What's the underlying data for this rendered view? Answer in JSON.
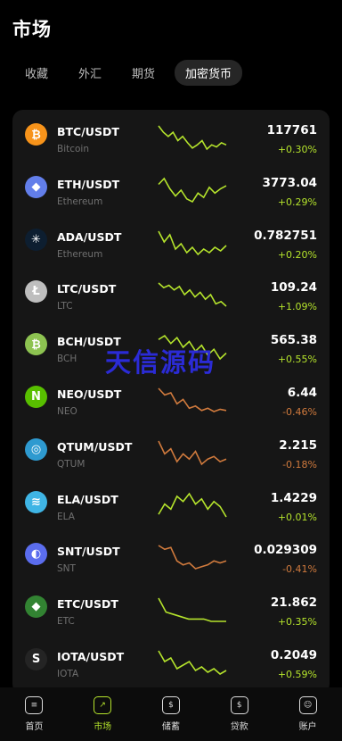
{
  "header": {
    "title": "市场"
  },
  "tabs": [
    {
      "label": "收藏",
      "active": false
    },
    {
      "label": "外汇",
      "active": false
    },
    {
      "label": "期货",
      "active": false
    },
    {
      "label": "加密货币",
      "active": true
    }
  ],
  "colors": {
    "up": "#b5e42c",
    "down": "#d07a3d",
    "background": "#000000",
    "card": "#161616"
  },
  "markets": [
    {
      "pair": "BTC/USDT",
      "name": "Bitcoin",
      "price": "117761",
      "change": "+0.30%",
      "trend": "up",
      "icon": "bitcoin-icon",
      "icon_glyph": "₿",
      "icon_color": "#f7931a",
      "spark": [
        24,
        30,
        34,
        30,
        38,
        34,
        40,
        45,
        42,
        38,
        46,
        42,
        44,
        40,
        42
      ]
    },
    {
      "pair": "ETH/USDT",
      "name": "Ethereum",
      "price": "3773.04",
      "change": "+0.29%",
      "trend": "up",
      "icon": "ethereum-icon",
      "icon_glyph": "◆",
      "icon_color": "#627eea",
      "spark": [
        30,
        26,
        33,
        38,
        34,
        40,
        42,
        36,
        39,
        32,
        36,
        33,
        31
      ]
    },
    {
      "pair": "ADA/USDT",
      "name": "Ethereum",
      "price": "0.782751",
      "change": "+0.20%",
      "trend": "up",
      "icon": "cardano-icon",
      "icon_glyph": "✳",
      "icon_color": "#0d1e30",
      "spark": [
        28,
        34,
        30,
        38,
        35,
        40,
        37,
        41,
        38,
        40,
        37,
        39,
        36
      ]
    },
    {
      "pair": "LTC/USDT",
      "name": "LTC",
      "price": "109.24",
      "change": "+1.09%",
      "trend": "up",
      "icon": "litecoin-icon",
      "icon_glyph": "Ł",
      "icon_color": "#bebebe",
      "spark": [
        24,
        28,
        26,
        30,
        27,
        34,
        30,
        36,
        32,
        38,
        34,
        42,
        40,
        44
      ]
    },
    {
      "pair": "BCH/USDT",
      "name": "BCH",
      "price": "565.38",
      "change": "+0.55%",
      "trend": "up",
      "icon": "bitcoin-cash-icon",
      "icon_glyph": "₿",
      "icon_color": "#8dc351",
      "spark": [
        28,
        26,
        30,
        27,
        32,
        29,
        34,
        31,
        36,
        33,
        38,
        35
      ]
    },
    {
      "pair": "NEO/USDT",
      "name": "NEO",
      "price": "6.44",
      "change": "-0.46%",
      "trend": "down",
      "icon": "neo-icon",
      "icon_glyph": "N",
      "icon_color": "#58bf00",
      "spark": [
        22,
        28,
        26,
        36,
        32,
        40,
        38,
        42,
        40,
        43,
        41,
        42
      ]
    },
    {
      "pair": "QTUM/USDT",
      "name": "QTUM",
      "price": "2.215",
      "change": "-0.18%",
      "trend": "down",
      "icon": "qtum-icon",
      "icon_glyph": "◎",
      "icon_color": "#2e9ad0",
      "spark": [
        20,
        30,
        26,
        36,
        30,
        34,
        28,
        38,
        34,
        32,
        36,
        34
      ]
    },
    {
      "pair": "ELA/USDT",
      "name": "ELA",
      "price": "1.4229",
      "change": "+0.01%",
      "trend": "up",
      "icon": "elastos-icon",
      "icon_glyph": "≋",
      "icon_color": "#3fb5e5",
      "spark": [
        38,
        30,
        34,
        24,
        28,
        22,
        30,
        26,
        34,
        28,
        32,
        40
      ]
    },
    {
      "pair": "SNT/USDT",
      "name": "SNT",
      "price": "0.029309",
      "change": "-0.41%",
      "trend": "down",
      "icon": "status-icon",
      "icon_glyph": "◐",
      "icon_color": "#5b6dee",
      "spark": [
        20,
        22,
        21,
        28,
        30,
        29,
        32,
        31,
        30,
        28,
        29,
        28
      ]
    },
    {
      "pair": "ETC/USDT",
      "name": "ETC",
      "price": "21.862",
      "change": "+0.35%",
      "trend": "up",
      "icon": "ethereum-classic-icon",
      "icon_glyph": "◆",
      "icon_color": "#328332",
      "spark": [
        18,
        24,
        25,
        26,
        27,
        27,
        27,
        28,
        28,
        28
      ]
    },
    {
      "pair": "IOTA/USDT",
      "name": "IOTA",
      "price": "0.2049",
      "change": "+0.59%",
      "trend": "up",
      "icon": "iota-icon",
      "icon_glyph": "S",
      "icon_color": "#242424",
      "spark": [
        22,
        28,
        26,
        32,
        30,
        28,
        33,
        31,
        34,
        32,
        35,
        33
      ]
    }
  ],
  "watermark": "天信源码",
  "bottom_nav": [
    {
      "label": "首页",
      "icon": "home-icon",
      "glyph": "≡",
      "active": false
    },
    {
      "label": "市场",
      "icon": "market-icon",
      "glyph": "↗",
      "active": true
    },
    {
      "label": "储蓄",
      "icon": "savings-icon",
      "glyph": "$",
      "active": false
    },
    {
      "label": "贷款",
      "icon": "loan-icon",
      "glyph": "$",
      "active": false
    },
    {
      "label": "账户",
      "icon": "account-icon",
      "glyph": "☺",
      "active": false
    }
  ]
}
